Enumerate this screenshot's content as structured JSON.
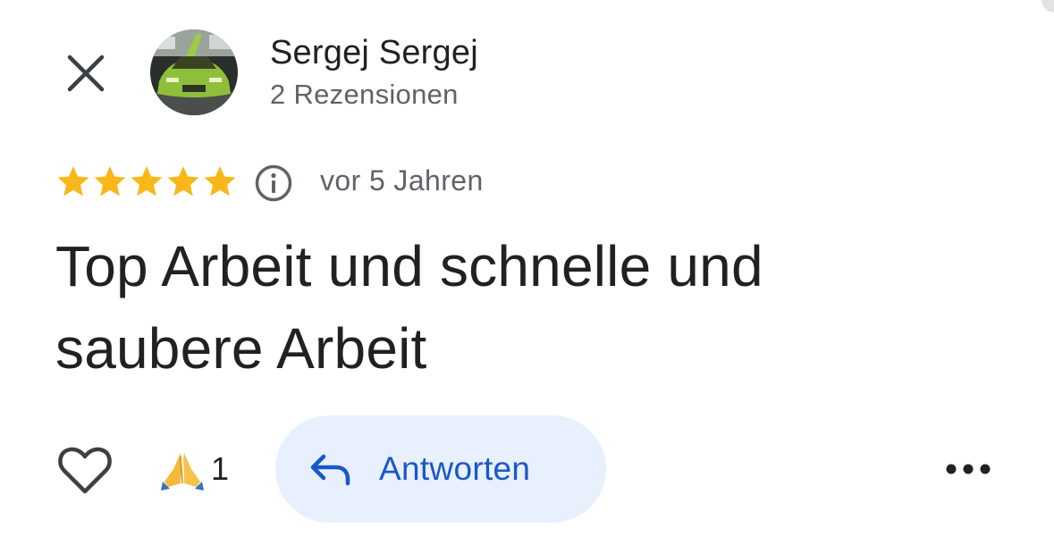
{
  "header": {
    "user_name": "Sergej Sergej",
    "review_count": "2 Rezensionen"
  },
  "review": {
    "rating": 5,
    "max_rating": 5,
    "date": "vor 5 Jahren",
    "text": "Top Arbeit und schnelle und saubere Arbeit"
  },
  "actions": {
    "reaction_emoji": "pray-emoji",
    "reaction_count": "1",
    "reply_label": "Antworten"
  },
  "colors": {
    "star": "#f9b719",
    "reply_bg": "#e8f0fe",
    "reply_text": "#1a57c8"
  }
}
